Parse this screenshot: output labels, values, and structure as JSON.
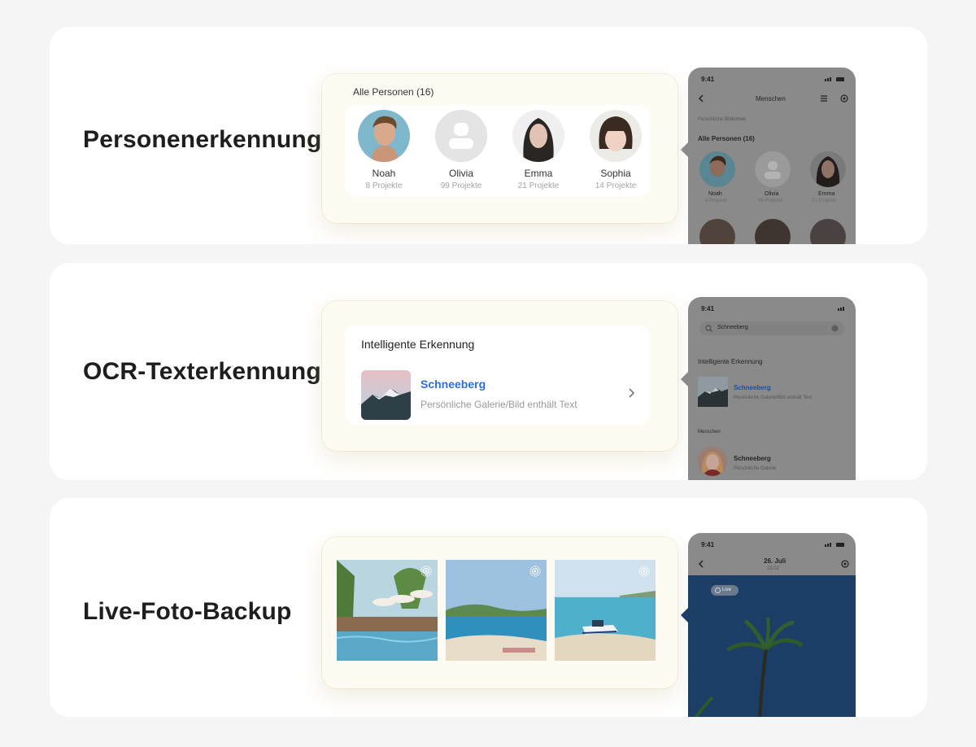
{
  "sections": {
    "people": {
      "title": "Personenerkennung",
      "card": {
        "label": "Alle Personen (16)",
        "persons": [
          {
            "name": "Noah",
            "count": "8 Projekte"
          },
          {
            "name": "Olivia",
            "count": "99 Projekte"
          },
          {
            "name": "Emma",
            "count": "21 Projekte"
          },
          {
            "name": "Sophia",
            "count": "14 Projekte"
          }
        ]
      },
      "phone": {
        "time": "9:41",
        "nav_title": "Menschen",
        "library": "Persönliche Bibliothek",
        "list_label": "Alle Personen (16)",
        "persons": [
          {
            "name": "Noah",
            "count": "8 Projekte"
          },
          {
            "name": "Olivia",
            "count": "99 Projekte"
          },
          {
            "name": "Emma",
            "count": "21 Projekte"
          }
        ]
      }
    },
    "ocr": {
      "title": "OCR-Texterkennung",
      "card": {
        "label": "Intelligente Erkennung",
        "result_title": "Schneeberg",
        "result_path": "Persönliche Galerie/Bild enthält Text"
      },
      "phone": {
        "time": "9:41",
        "search_value": "Schneeberg",
        "section_label": "Intelligente Erkennung",
        "result_title": "Schneeberg",
        "result_path": "Persönliche Galerie/Bild enthält Text",
        "people_label": "Menschen",
        "person_title": "Schneeberg",
        "person_path": "Persönliche Galerie"
      }
    },
    "live": {
      "title": "Live-Foto-Backup",
      "phone": {
        "time": "9:41",
        "date": "26. Juli",
        "clock": "23:02",
        "badge": "Live"
      }
    }
  },
  "colors": {
    "accent_blue": "#2d6fd9",
    "section_bg": "#ffffff",
    "page_bg": "#f5f5f5",
    "phone_overlay": "#8a8a8a"
  },
  "icons": [
    "back-chevron-icon",
    "list-icon",
    "settings-icon",
    "live-photo-icon",
    "search-icon",
    "clear-icon",
    "chevron-right-icon"
  ]
}
